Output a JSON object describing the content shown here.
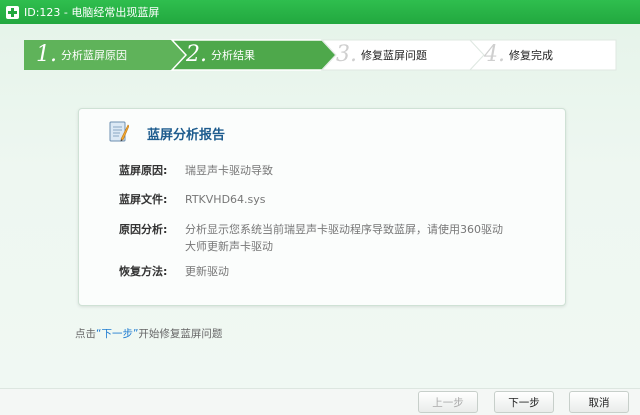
{
  "window": {
    "title": "ID:123 - 电脑经常出现蓝屏"
  },
  "steps": [
    {
      "num": "1.",
      "label": "分析蓝屏原因",
      "state": "done"
    },
    {
      "num": "2.",
      "label": "分析结果",
      "state": "done"
    },
    {
      "num": "3.",
      "label": "修复蓝屏问题",
      "state": "todo"
    },
    {
      "num": "4.",
      "label": "修复完成",
      "state": "todo"
    }
  ],
  "report": {
    "title": "蓝屏分析报告",
    "rows": [
      {
        "key": "蓝屏原因:",
        "value": "瑞昱声卡驱动导致"
      },
      {
        "key": "蓝屏文件:",
        "value": "RTKVHD64.sys"
      },
      {
        "key": "原因分析:",
        "value": "分析显示您系统当前瑞昱声卡驱动程序导致蓝屏，请使用360驱动大师更新声卡驱动"
      },
      {
        "key": "恢复方法:",
        "value": "更新驱动"
      }
    ]
  },
  "hint": {
    "prefix": "点击",
    "highlight": "“下一步”",
    "suffix": "开始修复蓝屏问题"
  },
  "buttons": {
    "prev": "上一步",
    "next": "下一步",
    "cancel": "取消"
  },
  "colors": {
    "accent": "#22a83f",
    "step_done": "#5fb35a",
    "step_todo": "#ffffff",
    "title_blue": "#1e5c8e"
  }
}
